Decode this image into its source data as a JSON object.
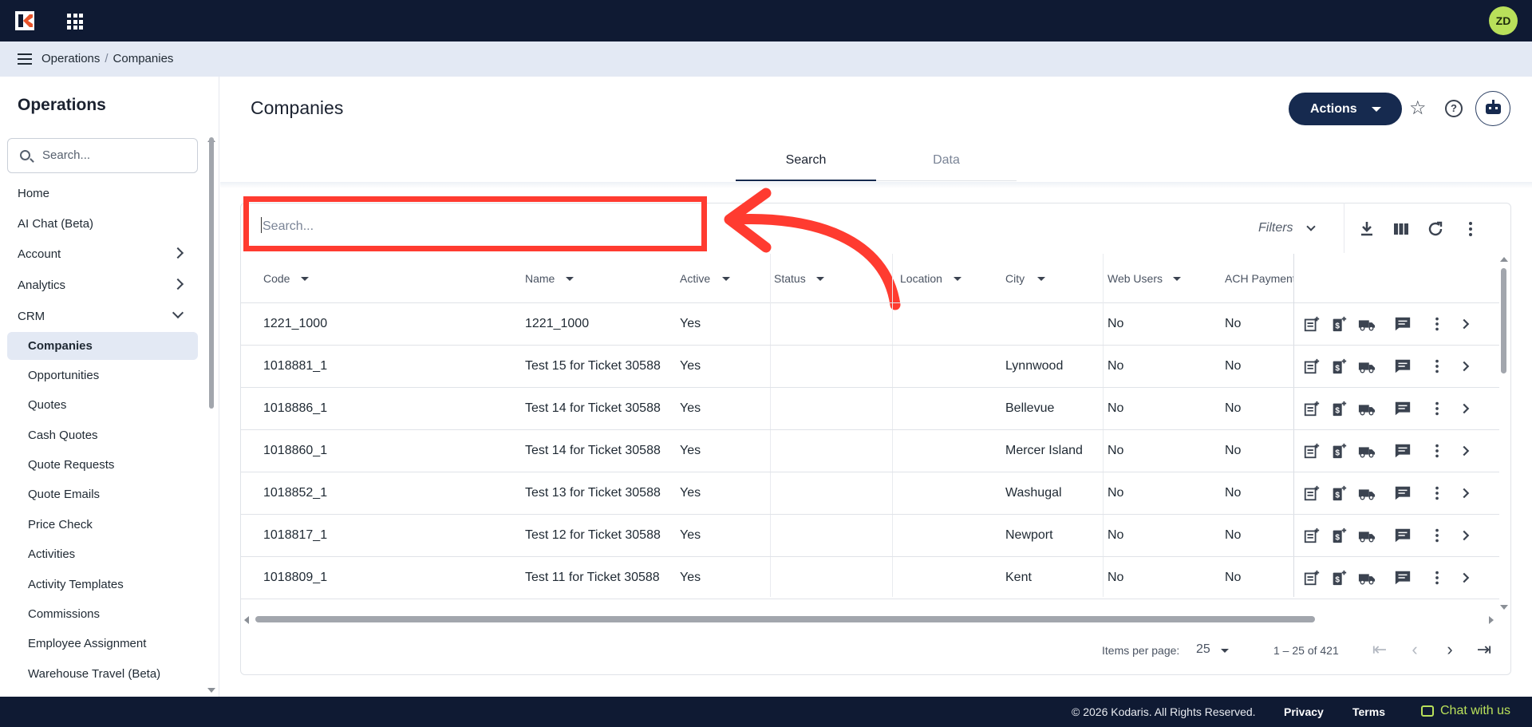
{
  "topbar": {
    "avatar_initials": "ZD",
    "brand_color": "#0f1a33",
    "avatar_color": "#b9e05a"
  },
  "breadcrumb": {
    "section": "Operations",
    "page": "Companies"
  },
  "sidebar": {
    "title": "Operations",
    "search_placeholder": "Search...",
    "items": [
      {
        "label": "Home"
      },
      {
        "label": "AI Chat (Beta)"
      },
      {
        "label": "Account"
      },
      {
        "label": "Analytics"
      },
      {
        "label": "CRM"
      }
    ],
    "crm_items": [
      {
        "label": "Companies"
      },
      {
        "label": "Opportunities"
      },
      {
        "label": "Quotes"
      },
      {
        "label": "Cash Quotes"
      },
      {
        "label": "Quote Requests"
      },
      {
        "label": "Quote Emails"
      },
      {
        "label": "Price Check"
      },
      {
        "label": "Activities"
      },
      {
        "label": "Activity Templates"
      },
      {
        "label": "Commissions"
      },
      {
        "label": "Employee Assignment"
      },
      {
        "label": "Warehouse Travel (Beta)"
      }
    ]
  },
  "header": {
    "title": "Companies",
    "actions_label": "Actions"
  },
  "tabs": [
    {
      "label": "Search"
    },
    {
      "label": "Data"
    }
  ],
  "toolbar": {
    "search_placeholder": "Search...",
    "filters_label": "Filters"
  },
  "table": {
    "columns": [
      "Code",
      "Name",
      "Active",
      "Status",
      "Location",
      "City",
      "Web Users",
      "ACH Payment"
    ],
    "rows": [
      {
        "code": "1221_1000",
        "name": "1221_1000",
        "active": "Yes",
        "city": "",
        "web_users": "No",
        "ach": "No"
      },
      {
        "code": "1018881_1",
        "name": "Test 15 for Ticket 30588",
        "active": "Yes",
        "city": "Lynnwood",
        "web_users": "No",
        "ach": "No"
      },
      {
        "code": "1018886_1",
        "name": "Test 14 for Ticket 30588",
        "active": "Yes",
        "city": "Bellevue",
        "web_users": "No",
        "ach": "No"
      },
      {
        "code": "1018860_1",
        "name": "Test 14 for Ticket 30588",
        "active": "Yes",
        "city": "Mercer Island",
        "web_users": "No",
        "ach": "No"
      },
      {
        "code": "1018852_1",
        "name": "Test 13 for Ticket 30588",
        "active": "Yes",
        "city": "Washugal",
        "web_users": "No",
        "ach": "No"
      },
      {
        "code": "1018817_1",
        "name": "Test 12 for Ticket 30588",
        "active": "Yes",
        "city": "Newport",
        "web_users": "No",
        "ach": "No"
      },
      {
        "code": "1018809_1",
        "name": "Test 11 for Ticket 30588",
        "active": "Yes",
        "city": "Kent",
        "web_users": "No",
        "ach": "No"
      }
    ]
  },
  "pager": {
    "items_per_page_label": "Items per page:",
    "page_size": "25",
    "range": "1 – 25 of 421"
  },
  "footer": {
    "copyright": "© 2026 Kodaris. All Rights Reserved.",
    "privacy": "Privacy",
    "terms": "Terms",
    "chat": "Chat with us"
  },
  "annotation_color": "#ff3b30"
}
